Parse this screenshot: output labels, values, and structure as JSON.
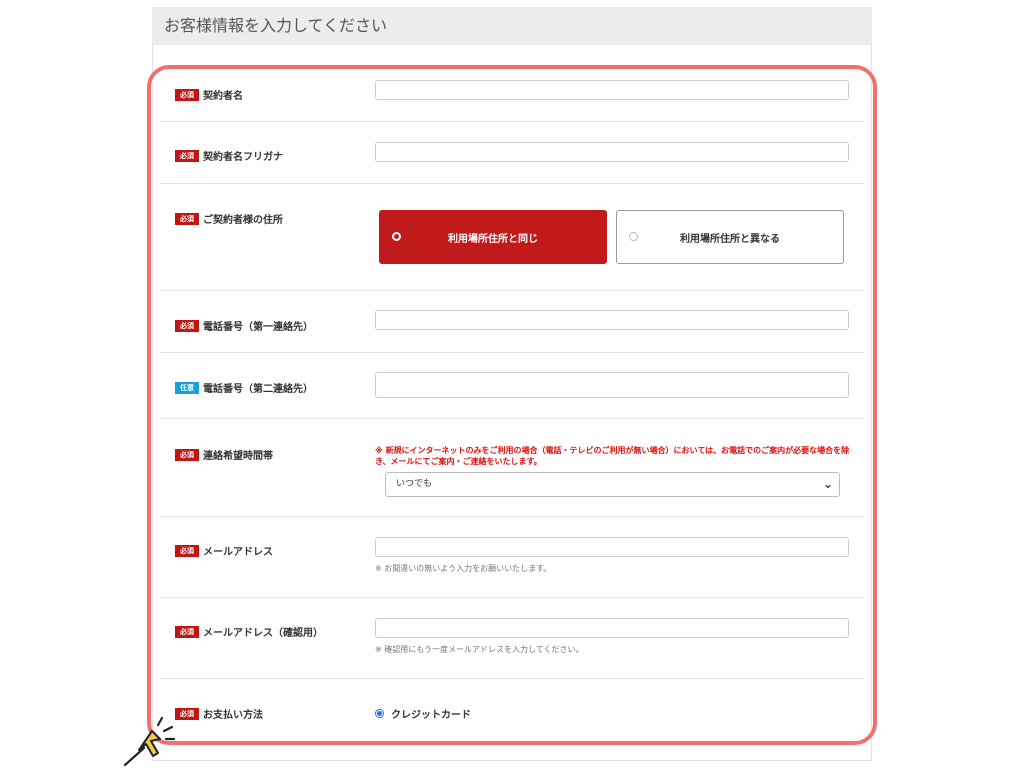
{
  "header": {
    "title": "お客様情報を入力してください"
  },
  "badges": {
    "required": "必須",
    "optional": "任意"
  },
  "fields": {
    "contract_name": {
      "label": "契約者名",
      "value": ""
    },
    "contract_kana": {
      "label": "契約者名フリガナ",
      "value": ""
    },
    "address": {
      "label": "ご契約者様の住所",
      "options": [
        "利用場所住所と同じ",
        "利用場所住所と異なる"
      ],
      "selected": "利用場所住所と同じ"
    },
    "phone1": {
      "label": "電話番号（第一連絡先）",
      "value": ""
    },
    "phone2": {
      "label": "電話番号（第二連絡先）",
      "value": ""
    },
    "contact_time": {
      "label": "連絡希望時間帯",
      "warning": "※ 新規にインターネットのみをご利用の場合（電話・テレビのご利用が無い場合）においては、お電話でのご案内が必要な場合を除き、メールにてご案内・ご連絡をいたします。",
      "value": "いつでも"
    },
    "email": {
      "label": "メールアドレス",
      "value": "",
      "note": "※ お間違いの無いよう入力をお願いいたします。"
    },
    "email_confirm": {
      "label": "メールアドレス（確認用）",
      "value": "",
      "note": "※ 確認用にもう一度メールアドレスを入力してください。"
    },
    "payment": {
      "label": "お支払い方法",
      "option": "クレジットカード",
      "selected": true
    }
  },
  "colors": {
    "accent": "#c01a1a",
    "highlight": "#f07070",
    "optional_badge": "#1a9fd6",
    "pointer": "#f5c84a"
  },
  "icons": {
    "select_chevron": "chevron-down-icon",
    "pointer": "pointing-hand-icon"
  }
}
